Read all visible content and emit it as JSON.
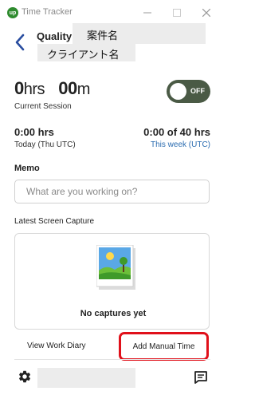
{
  "window": {
    "title": "Time Tracker",
    "logo_text": "up",
    "minimize_glyph": "—",
    "maximize_glyph": "☐",
    "close_glyph": "✕"
  },
  "header": {
    "project_name": "Quality",
    "redacted_project": "案件名",
    "redacted_client": "クライアント名"
  },
  "session": {
    "hours": "0",
    "hours_unit": "hrs",
    "minutes": "00",
    "minutes_unit": "m",
    "label": "Current Session",
    "toggle_label": "OFF",
    "toggle_on": false
  },
  "stats": {
    "today_hours": "0:00 hrs",
    "today_label": "Today (Thu UTC)",
    "week_hours": "0:00 of 40 hrs",
    "week_label": "This week (UTC)"
  },
  "memo": {
    "label": "Memo",
    "placeholder": "What are you working on?",
    "value": ""
  },
  "capture": {
    "label": "Latest Screen Capture",
    "icon": "photo-icon",
    "empty_text": "No captures yet"
  },
  "actions": {
    "work_diary": "View Work Diary",
    "add_manual_time": "Add Manual Time"
  },
  "footer": {
    "settings_icon": "gear-icon",
    "message_icon": "message-icon"
  },
  "colors": {
    "toggle_bg": "#4a5a45",
    "link_blue": "#2b6cb0",
    "highlight_red": "#e0101a",
    "brand_green": "#2e8b2e"
  }
}
